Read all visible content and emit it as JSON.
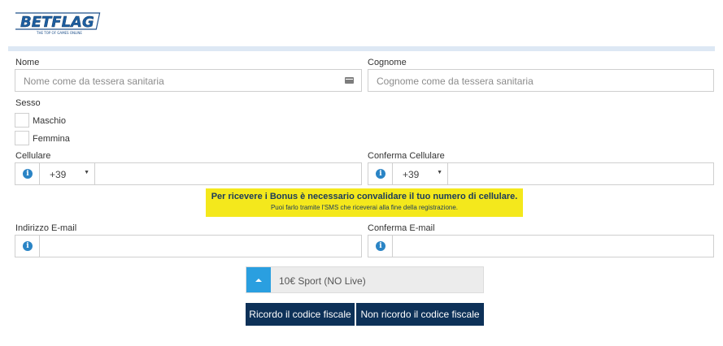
{
  "brand": {
    "logo_text": "BETFLAG",
    "tagline": "THE TOP OF GAMES ONLINE",
    "colors": {
      "primary": "#0d3158",
      "accent": "#2a9fe0",
      "notice": "#f4e81c"
    }
  },
  "form": {
    "nome": {
      "label": "Nome",
      "placeholder": "Nome come da tessera sanitaria",
      "icon": "id-card-icon"
    },
    "cognome": {
      "label": "Cognome",
      "placeholder": "Cognome come da tessera sanitaria"
    },
    "sesso": {
      "label": "Sesso",
      "options": [
        "Maschio",
        "Femmina"
      ]
    },
    "cellulare": {
      "label": "Cellulare",
      "prefix": "+39",
      "value": ""
    },
    "conferma_cellulare": {
      "label": "Conferma Cellulare",
      "prefix": "+39",
      "value": ""
    },
    "notice": {
      "title": "Per ricevere i Bonus è necessario convalidare il tuo numero di cellulare.",
      "subtitle": "Puoi farlo tramite l'SMS che riceverai alla fine della registrazione."
    },
    "email": {
      "label": "Indirizzo E-mail",
      "value": ""
    },
    "conferma_email": {
      "label": "Conferma E-mail",
      "value": ""
    },
    "bonus": {
      "selected": "10€ Sport (NO Live)"
    },
    "buttons": {
      "ricordo": "Ricordo il codice fiscale",
      "non_ricordo": "Non ricordo il codice fiscale"
    }
  }
}
